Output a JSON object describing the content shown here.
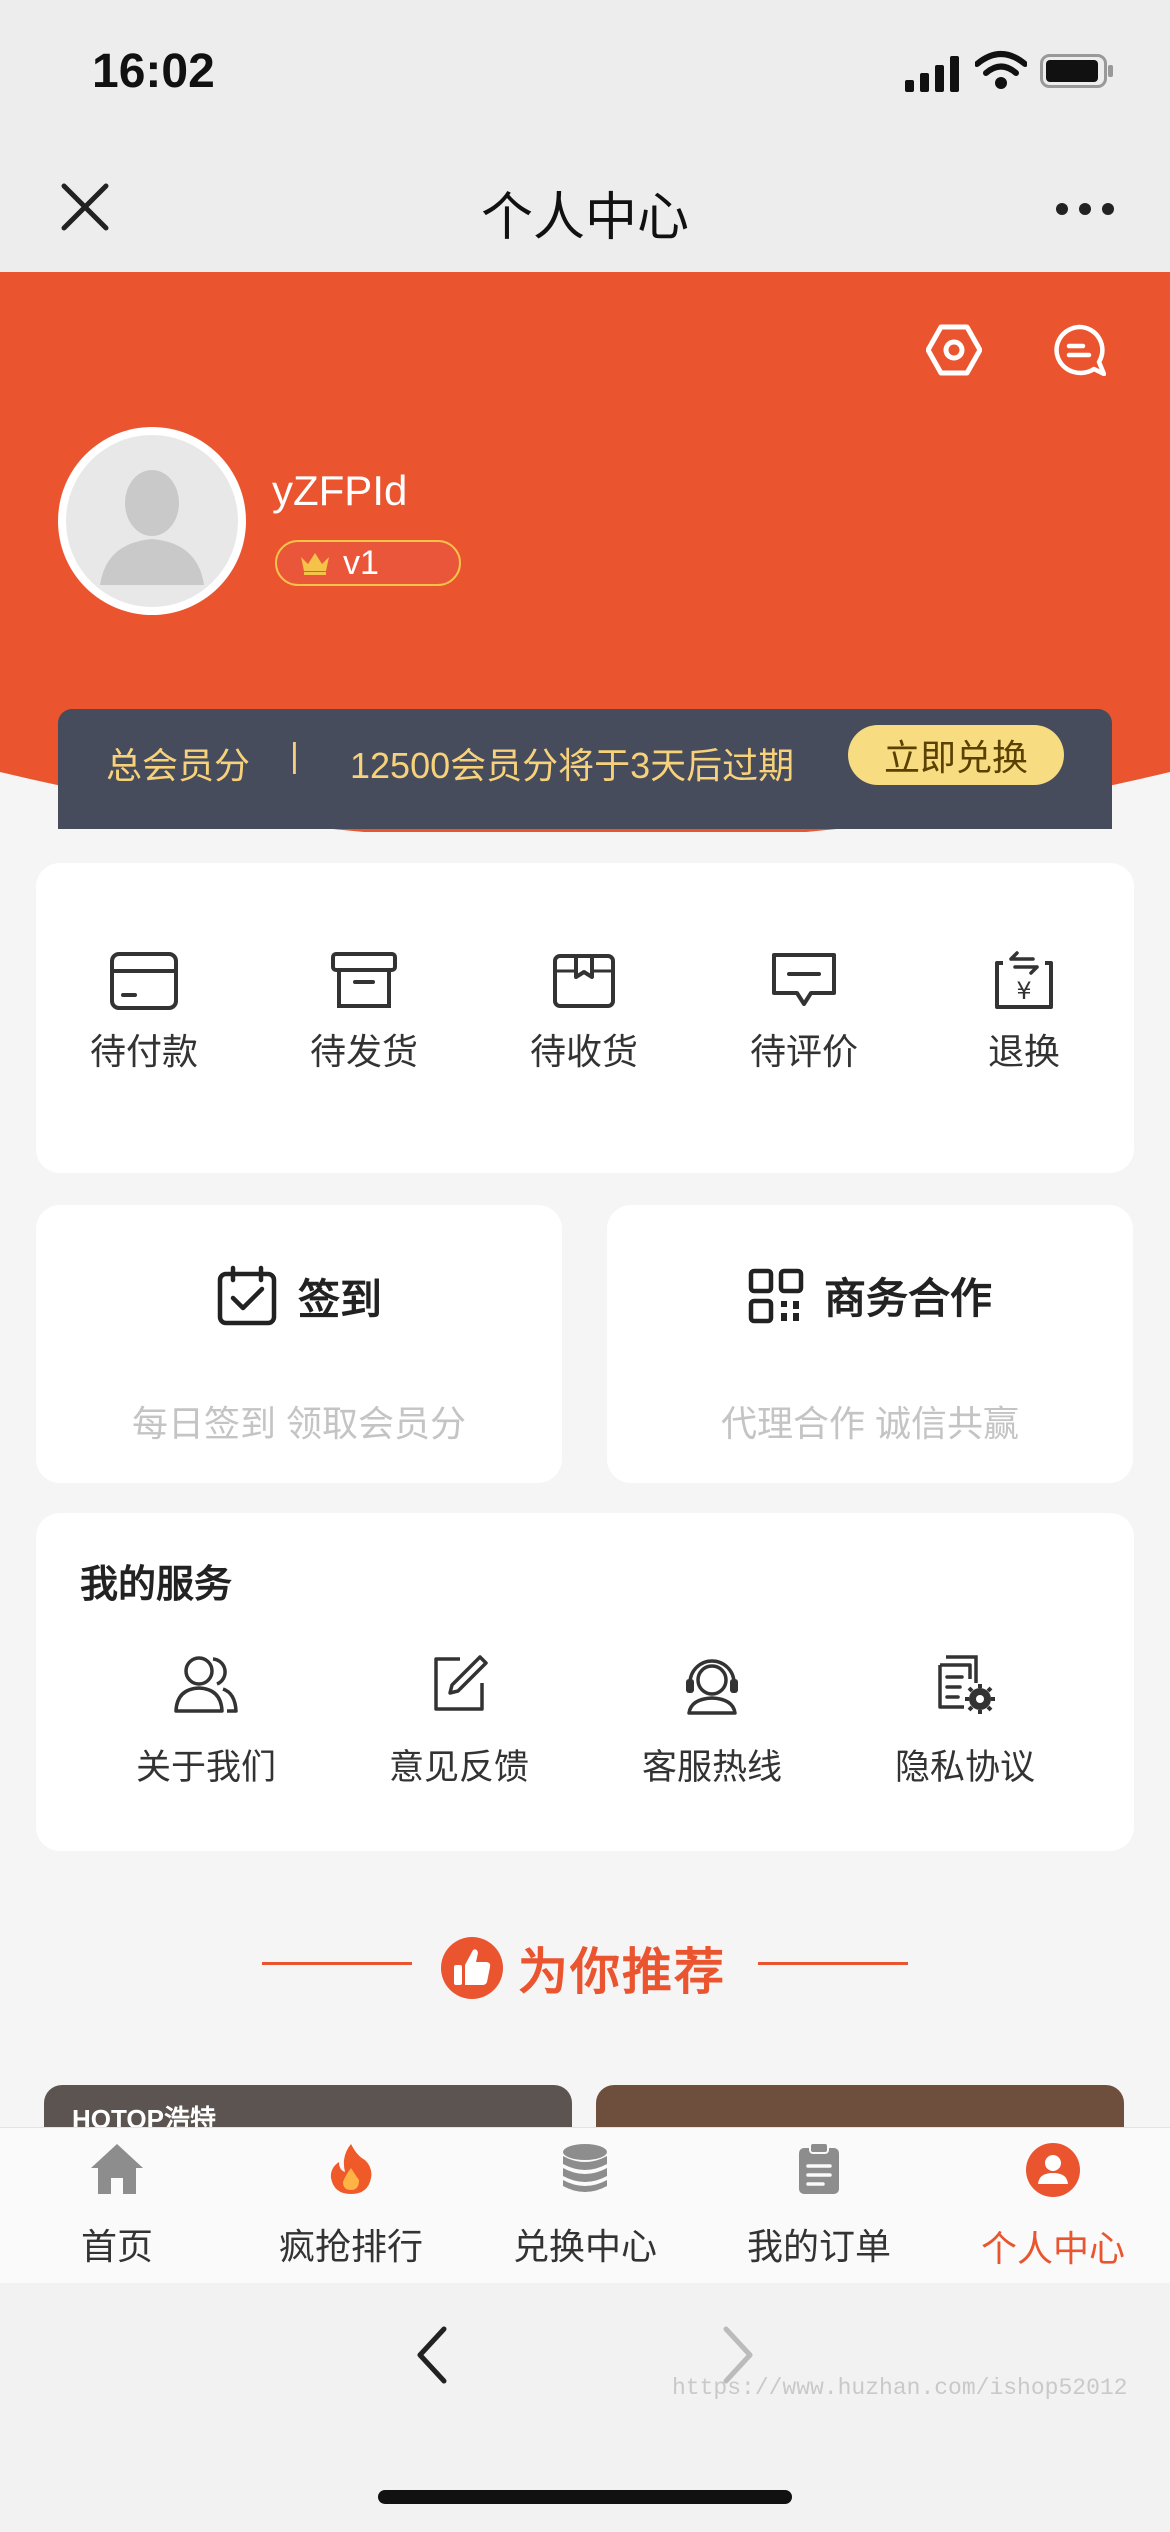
{
  "status_bar": {
    "time": "16:02"
  },
  "nav": {
    "title": "个人中心",
    "close_icon": "close-icon",
    "more_icon": "more-dots-icon"
  },
  "header": {
    "bg_color": "#ea5530",
    "username": "yZFPId",
    "level": "v1",
    "settings_icon": "settings-icon",
    "message_icon": "message-icon"
  },
  "points": {
    "label": "总会员分",
    "separator": "|",
    "expire_text": "12500会员分将于3天后过期",
    "button": "立即兑换"
  },
  "orders": [
    {
      "label": "待付款",
      "icon": "wallet-card-icon"
    },
    {
      "label": "待发货",
      "icon": "box-icon"
    },
    {
      "label": "待收货",
      "icon": "package-icon"
    },
    {
      "label": "待评价",
      "icon": "comment-icon"
    },
    {
      "label": "退换",
      "icon": "refund-icon"
    }
  ],
  "checkin": {
    "title": "签到",
    "subtitle": "每日签到 领取会员分",
    "icon": "calendar-check-icon"
  },
  "business": {
    "title": "商务合作",
    "subtitle": "代理合作 诚信共赢",
    "icon": "qrcode-icon"
  },
  "services": {
    "title": "我的服务",
    "items": [
      {
        "label": "关于我们",
        "icon": "users-icon"
      },
      {
        "label": "意见反馈",
        "icon": "edit-icon"
      },
      {
        "label": "客服热线",
        "icon": "headset-icon"
      },
      {
        "label": "隐私协议",
        "icon": "document-gear-icon"
      }
    ]
  },
  "recommend": {
    "title": "为你推荐",
    "icon": "thumbs-up-icon"
  },
  "products": [
    {
      "brand": "HOTOP浩特"
    },
    {
      "brand": ""
    }
  ],
  "tabbar": {
    "items": [
      {
        "label": "首页",
        "icon": "home-icon"
      },
      {
        "label": "疯抢排行",
        "icon": "fire-icon"
      },
      {
        "label": "兑换中心",
        "icon": "coins-icon"
      },
      {
        "label": "我的订单",
        "icon": "clipboard-icon"
      },
      {
        "label": "个人中心",
        "icon": "user-circle-icon"
      }
    ],
    "active_index": 4,
    "active_color": "#ea5530"
  },
  "browser": {
    "watermark": "https://www.huzhan.com/ishop52012"
  }
}
